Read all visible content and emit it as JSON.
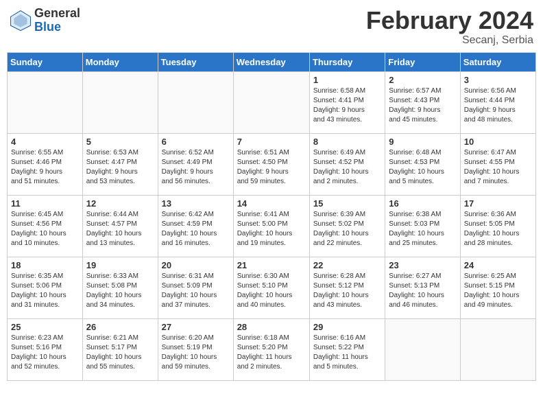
{
  "header": {
    "logo_general": "General",
    "logo_blue": "Blue",
    "month_title": "February 2024",
    "subtitle": "Secanj, Serbia"
  },
  "weekdays": [
    "Sunday",
    "Monday",
    "Tuesday",
    "Wednesday",
    "Thursday",
    "Friday",
    "Saturday"
  ],
  "weeks": [
    [
      {
        "day": "",
        "info": ""
      },
      {
        "day": "",
        "info": ""
      },
      {
        "day": "",
        "info": ""
      },
      {
        "day": "",
        "info": ""
      },
      {
        "day": "1",
        "info": "Sunrise: 6:58 AM\nSunset: 4:41 PM\nDaylight: 9 hours\nand 43 minutes."
      },
      {
        "day": "2",
        "info": "Sunrise: 6:57 AM\nSunset: 4:43 PM\nDaylight: 9 hours\nand 45 minutes."
      },
      {
        "day": "3",
        "info": "Sunrise: 6:56 AM\nSunset: 4:44 PM\nDaylight: 9 hours\nand 48 minutes."
      }
    ],
    [
      {
        "day": "4",
        "info": "Sunrise: 6:55 AM\nSunset: 4:46 PM\nDaylight: 9 hours\nand 51 minutes."
      },
      {
        "day": "5",
        "info": "Sunrise: 6:53 AM\nSunset: 4:47 PM\nDaylight: 9 hours\nand 53 minutes."
      },
      {
        "day": "6",
        "info": "Sunrise: 6:52 AM\nSunset: 4:49 PM\nDaylight: 9 hours\nand 56 minutes."
      },
      {
        "day": "7",
        "info": "Sunrise: 6:51 AM\nSunset: 4:50 PM\nDaylight: 9 hours\nand 59 minutes."
      },
      {
        "day": "8",
        "info": "Sunrise: 6:49 AM\nSunset: 4:52 PM\nDaylight: 10 hours\nand 2 minutes."
      },
      {
        "day": "9",
        "info": "Sunrise: 6:48 AM\nSunset: 4:53 PM\nDaylight: 10 hours\nand 5 minutes."
      },
      {
        "day": "10",
        "info": "Sunrise: 6:47 AM\nSunset: 4:55 PM\nDaylight: 10 hours\nand 7 minutes."
      }
    ],
    [
      {
        "day": "11",
        "info": "Sunrise: 6:45 AM\nSunset: 4:56 PM\nDaylight: 10 hours\nand 10 minutes."
      },
      {
        "day": "12",
        "info": "Sunrise: 6:44 AM\nSunset: 4:57 PM\nDaylight: 10 hours\nand 13 minutes."
      },
      {
        "day": "13",
        "info": "Sunrise: 6:42 AM\nSunset: 4:59 PM\nDaylight: 10 hours\nand 16 minutes."
      },
      {
        "day": "14",
        "info": "Sunrise: 6:41 AM\nSunset: 5:00 PM\nDaylight: 10 hours\nand 19 minutes."
      },
      {
        "day": "15",
        "info": "Sunrise: 6:39 AM\nSunset: 5:02 PM\nDaylight: 10 hours\nand 22 minutes."
      },
      {
        "day": "16",
        "info": "Sunrise: 6:38 AM\nSunset: 5:03 PM\nDaylight: 10 hours\nand 25 minutes."
      },
      {
        "day": "17",
        "info": "Sunrise: 6:36 AM\nSunset: 5:05 PM\nDaylight: 10 hours\nand 28 minutes."
      }
    ],
    [
      {
        "day": "18",
        "info": "Sunrise: 6:35 AM\nSunset: 5:06 PM\nDaylight: 10 hours\nand 31 minutes."
      },
      {
        "day": "19",
        "info": "Sunrise: 6:33 AM\nSunset: 5:08 PM\nDaylight: 10 hours\nand 34 minutes."
      },
      {
        "day": "20",
        "info": "Sunrise: 6:31 AM\nSunset: 5:09 PM\nDaylight: 10 hours\nand 37 minutes."
      },
      {
        "day": "21",
        "info": "Sunrise: 6:30 AM\nSunset: 5:10 PM\nDaylight: 10 hours\nand 40 minutes."
      },
      {
        "day": "22",
        "info": "Sunrise: 6:28 AM\nSunset: 5:12 PM\nDaylight: 10 hours\nand 43 minutes."
      },
      {
        "day": "23",
        "info": "Sunrise: 6:27 AM\nSunset: 5:13 PM\nDaylight: 10 hours\nand 46 minutes."
      },
      {
        "day": "24",
        "info": "Sunrise: 6:25 AM\nSunset: 5:15 PM\nDaylight: 10 hours\nand 49 minutes."
      }
    ],
    [
      {
        "day": "25",
        "info": "Sunrise: 6:23 AM\nSunset: 5:16 PM\nDaylight: 10 hours\nand 52 minutes."
      },
      {
        "day": "26",
        "info": "Sunrise: 6:21 AM\nSunset: 5:17 PM\nDaylight: 10 hours\nand 55 minutes."
      },
      {
        "day": "27",
        "info": "Sunrise: 6:20 AM\nSunset: 5:19 PM\nDaylight: 10 hours\nand 59 minutes."
      },
      {
        "day": "28",
        "info": "Sunrise: 6:18 AM\nSunset: 5:20 PM\nDaylight: 11 hours\nand 2 minutes."
      },
      {
        "day": "29",
        "info": "Sunrise: 6:16 AM\nSunset: 5:22 PM\nDaylight: 11 hours\nand 5 minutes."
      },
      {
        "day": "",
        "info": ""
      },
      {
        "day": "",
        "info": ""
      }
    ]
  ]
}
